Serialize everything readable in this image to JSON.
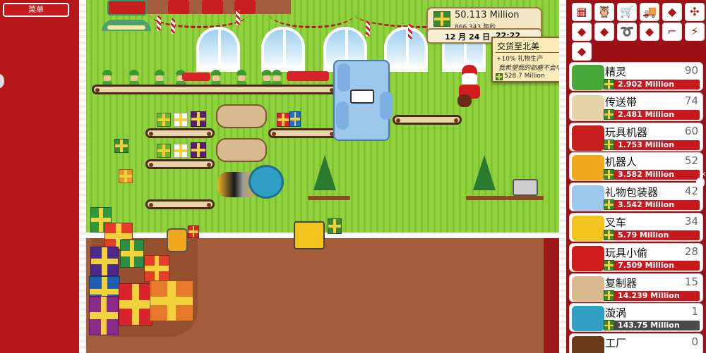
{
  "menu": {
    "label": "菜单"
  },
  "resources": {
    "gifts": "50.113 Million",
    "rate": "866,343 每秒",
    "date": "12 月 24 日",
    "time": "22:22"
  },
  "tooltip": {
    "title": "交货至北美",
    "bonus": "+10% 礼物生产",
    "quote": "我希望我的驯鹿不会中枪",
    "value": "528.7 Million"
  },
  "top_icons": [
    {
      "name": "rainbow-gifts-icon",
      "glyph": "▦"
    },
    {
      "name": "owl-icon",
      "glyph": "🦉"
    },
    {
      "name": "cart-icon",
      "glyph": "🛒"
    },
    {
      "name": "truck-icon",
      "glyph": "🚚"
    },
    {
      "name": "south-america-map-icon",
      "glyph": "◆"
    },
    {
      "name": "network-icon",
      "glyph": "✣"
    },
    {
      "name": "europe-map-icon",
      "glyph": "◆"
    },
    {
      "name": "asia-map-icon",
      "glyph": "◆"
    },
    {
      "name": "ribbon-icon",
      "glyph": "➰"
    },
    {
      "name": "africa-map-icon",
      "glyph": "◆"
    },
    {
      "name": "sunglasses-icon",
      "glyph": "⌐"
    },
    {
      "name": "lightning-icon",
      "glyph": "⚡"
    },
    {
      "name": "australia-map-icon",
      "glyph": "◆"
    }
  ],
  "buildings": [
    {
      "name": "精灵",
      "count": "90",
      "price": "2.902 Million",
      "affordable": true
    },
    {
      "name": "传送带",
      "count": "74",
      "price": "2.481 Million",
      "affordable": true
    },
    {
      "name": "玩具机器",
      "count": "60",
      "price": "1.753 Million",
      "affordable": true
    },
    {
      "name": "机器人",
      "count": "52",
      "price": "3.582 Million",
      "affordable": true
    },
    {
      "name": "礼物包装器",
      "count": "42",
      "price": "3.542 Million",
      "affordable": true
    },
    {
      "name": "叉车",
      "count": "34",
      "price": "5.79 Million",
      "affordable": true
    },
    {
      "name": "玩具小偷",
      "count": "28",
      "price": "7.509 Million",
      "affordable": true
    },
    {
      "name": "复制器",
      "count": "15",
      "price": "14.239 Million",
      "affordable": true
    },
    {
      "name": "漩涡",
      "count": "1",
      "price": "143.75 Million",
      "affordable": false
    },
    {
      "name": "工厂",
      "count": "0",
      "price": "",
      "affordable": true
    }
  ],
  "colors": {
    "red_panel": "#b4161a",
    "dark_red": "#9b1014",
    "wall_green": "#8fd23d",
    "floor_brown": "#a45d3b",
    "price_red": "#c8191e",
    "price_gray": "#4a4a4a",
    "tooltip_bg": "#fcebb8"
  }
}
